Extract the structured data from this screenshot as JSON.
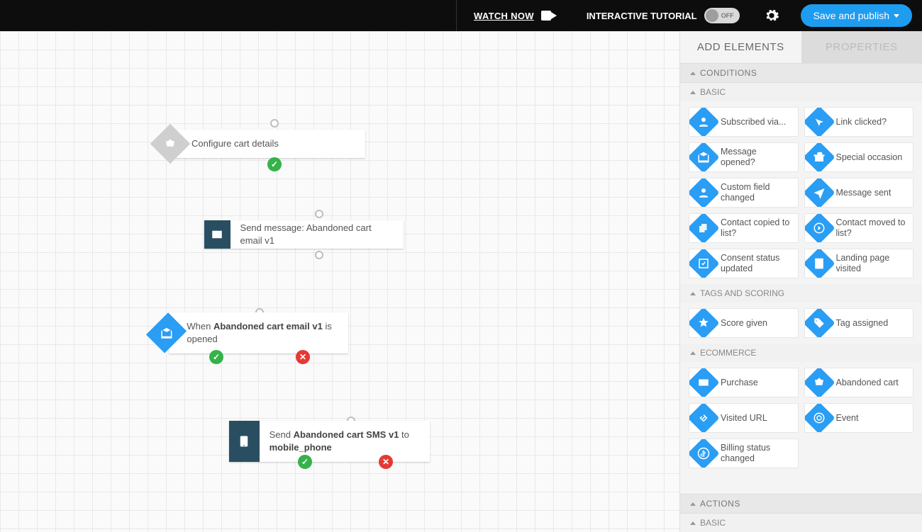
{
  "topbar": {
    "watch": "WATCH NOW",
    "tutorial": "INTERACTIVE TUTORIAL",
    "toggle": "OFF",
    "publish": "Save and publish"
  },
  "tabs": {
    "add": "ADD ELEMENTS",
    "props": "PROPERTIES"
  },
  "sections": {
    "conditions": "CONDITIONS",
    "basic": "BASIC",
    "tags": "TAGS AND SCORING",
    "ecom": "ECOMMERCE",
    "actions": "ACTIONS",
    "basic2": "BASIC"
  },
  "elements": {
    "subscribed": "Subscribed via...",
    "link": "Link clicked?",
    "opened": "Message opened?",
    "occasion": "Special occasion",
    "field": "Custom field changed",
    "sent": "Message sent",
    "copied": "Contact copied to list?",
    "moved": "Contact moved to list?",
    "consent": "Consent status updated",
    "landing": "Landing page visited",
    "score": "Score given",
    "tag": "Tag assigned",
    "purchase": "Purchase",
    "abandoned": "Abandoned cart",
    "url": "Visited URL",
    "event": "Event",
    "billing": "Billing status changed"
  },
  "nodes": {
    "configure": "Configure cart details",
    "sendmsg_pre": "Send message: ",
    "sendmsg_name": "Abandoned cart email v1",
    "when_pre": "When ",
    "when_name": "Abandoned cart email v1",
    "when_post": " is opened",
    "sms_pre": "Send ",
    "sms_name": "Abandoned cart SMS v1",
    "sms_mid": " to ",
    "sms_to": "mobile_phone"
  }
}
